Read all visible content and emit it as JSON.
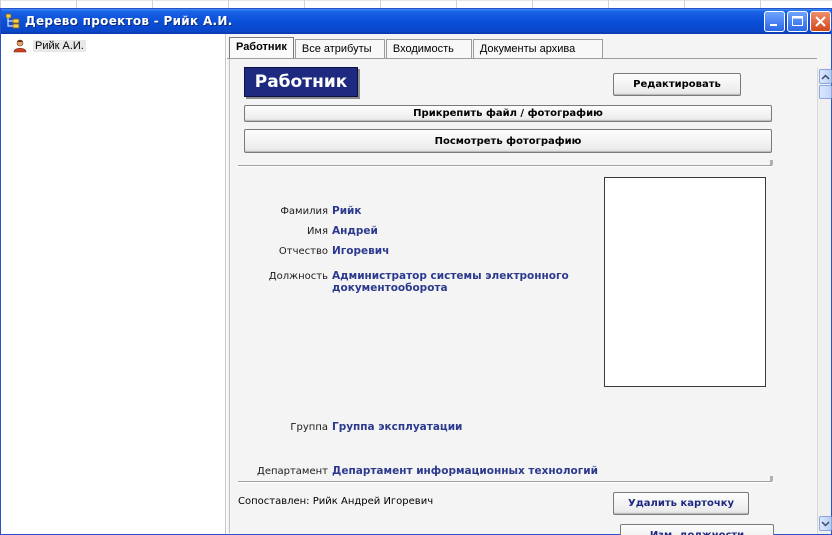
{
  "window": {
    "title": "Дерево проектов - Рийк А.И.",
    "accent_color": "#0a4fd8"
  },
  "tree": {
    "items": [
      {
        "label": "Рийк А.И.",
        "icon": "user-icon"
      }
    ]
  },
  "tabs": [
    {
      "label": "Работник",
      "active": true
    },
    {
      "label": "Все атрибуты",
      "active": false
    },
    {
      "label": "Входимость",
      "active": false
    },
    {
      "label": "Документы архива",
      "active": false
    }
  ],
  "employee": {
    "heading": "Работник",
    "heading_color": "#1e2a80",
    "edit_label": "Редактировать",
    "attach_label": "Прикрепить файл / фотографию",
    "view_photo_label": "Посмотреть фотографию",
    "fields": {
      "surname": {
        "label": "Фамилия",
        "value": "Рийк"
      },
      "name": {
        "label": "Имя",
        "value": "Андрей"
      },
      "patronymic": {
        "label": "Отчество",
        "value": "Игоревич"
      },
      "position": {
        "label": "Должность",
        "value": "Администратор системы электронного документооборота"
      },
      "group": {
        "label": "Группа",
        "value": "Группа эксплуатации"
      },
      "department": {
        "label": "Департамент",
        "value": "Департамент информационных технологий"
      }
    },
    "matched_text": "Сопоставлен: Рийк Андрей Игоревич",
    "delete_card_label": "Удалить карточку",
    "change_position_label": "Изм. должности",
    "value_color": "#2c3a8e"
  }
}
